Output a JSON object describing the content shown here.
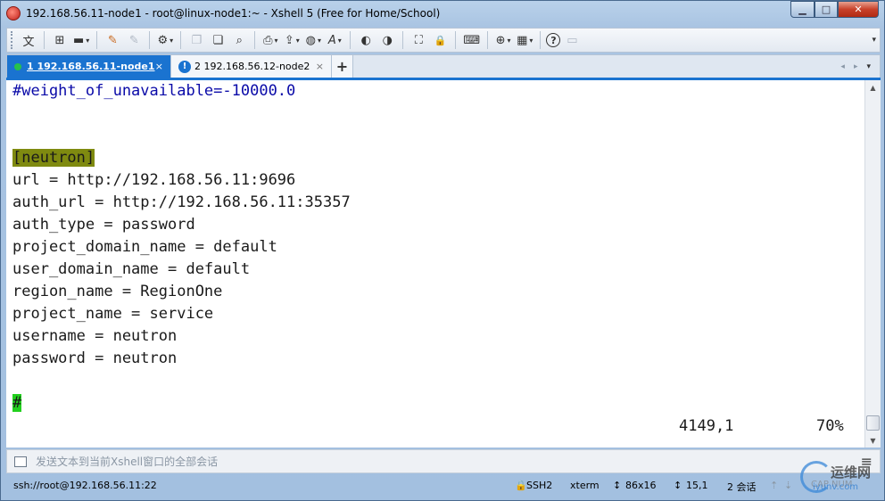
{
  "window": {
    "title": "192.168.56.11-node1 - root@linux-node1:~ - Xshell 5 (Free for Home/School)",
    "controls": {
      "minimize": "▁",
      "maximize": "□",
      "close": "✕"
    }
  },
  "toolbar": {
    "items": [
      {
        "name": "language-icon",
        "glyph": "文",
        "caret": true
      },
      {
        "name": "new-session-icon",
        "glyph": "⊞",
        "caret": false
      },
      {
        "name": "open-folder-icon",
        "glyph": "▬",
        "caret": true
      },
      {
        "name": "reconnect-icon",
        "glyph": "✎",
        "caret": false
      },
      {
        "name": "disconnect-icon",
        "glyph": "✎",
        "caret": false
      },
      {
        "name": "session-properties-icon",
        "glyph": "⚙",
        "caret": true
      },
      {
        "name": "copy-icon",
        "glyph": "❐",
        "caret": false
      },
      {
        "name": "paste-icon",
        "glyph": "❏",
        "caret": false
      },
      {
        "name": "find-icon",
        "glyph": "⌕",
        "caret": false
      },
      {
        "name": "print-icon",
        "glyph": "⎙",
        "caret": true
      },
      {
        "name": "transfer-icon",
        "glyph": "⇪",
        "caret": true
      },
      {
        "name": "globe-icon",
        "glyph": "◍",
        "caret": true
      },
      {
        "name": "font-icon",
        "glyph": "A",
        "caret": true
      },
      {
        "name": "xftp-icon",
        "glyph": "◐",
        "caret": false
      },
      {
        "name": "xmanager-icon",
        "glyph": "◑",
        "caret": false
      },
      {
        "name": "fullscreen-icon",
        "glyph": "⛶",
        "caret": false
      },
      {
        "name": "lock-icon",
        "glyph": "🔒",
        "caret": false
      },
      {
        "name": "keyboard-icon",
        "glyph": "⌨",
        "caret": false
      },
      {
        "name": "compose-icon",
        "glyph": "⊕",
        "caret": true
      },
      {
        "name": "layout-icon",
        "glyph": "▦",
        "caret": true
      },
      {
        "name": "help-icon",
        "glyph": "?",
        "caret": false
      },
      {
        "name": "chat-icon",
        "glyph": "▭",
        "caret": false
      }
    ],
    "overflow": "▾"
  },
  "tabs": [
    {
      "label": "1 192.168.56.11-node1",
      "close": "×",
      "status": "connected"
    },
    {
      "label": "2 192.168.56.12-node2",
      "close": "×",
      "status": "alert"
    }
  ],
  "tabbar": {
    "add": "+",
    "prev": "◂",
    "next": "▸",
    "menu": "▾"
  },
  "terminal": {
    "lines": [
      {
        "text": "#weight_of_unavailable=-10000.0",
        "style": "comment"
      },
      {
        "text": "",
        "style": "plain"
      },
      {
        "text": "",
        "style": "plain"
      },
      {
        "text": "[neutron]",
        "style": "section"
      },
      {
        "text": "url = http://192.168.56.11:9696",
        "style": "plain"
      },
      {
        "text": "auth_url = http://192.168.56.11:35357",
        "style": "plain"
      },
      {
        "text": "auth_type = password",
        "style": "plain"
      },
      {
        "text": "project_domain_name = default",
        "style": "plain"
      },
      {
        "text": "user_domain_name = default",
        "style": "plain"
      },
      {
        "text": "region_name = RegionOne",
        "style": "plain"
      },
      {
        "text": "project_name = service",
        "style": "plain"
      },
      {
        "text": "username = neutron",
        "style": "plain"
      },
      {
        "text": "password = neutron",
        "style": "plain"
      },
      {
        "text": "",
        "style": "plain"
      },
      {
        "text": "#",
        "style": "cursor"
      }
    ],
    "position": "4149,1",
    "percent": "70%"
  },
  "sendbar": {
    "placeholder": "发送文本到当前Xshell窗口的全部会话",
    "menu": "≡"
  },
  "statusbar": {
    "connection": "ssh://root@192.168.56.11:22",
    "protocol": "SSH2",
    "terminal_type": "xterm",
    "size": "86x16",
    "cursor": "15,1",
    "sessions": "2 会话",
    "up": "⇡",
    "down": "⇣",
    "caps": "CAP NUM"
  },
  "watermark": {
    "brand": "运维网",
    "domain": "iyunv.com"
  },
  "colors": {
    "tab_active": "#1a73d0",
    "comment": "#0a0aa8",
    "section_highlight": "#7f8a10",
    "cursor_highlight": "#22d01e"
  }
}
